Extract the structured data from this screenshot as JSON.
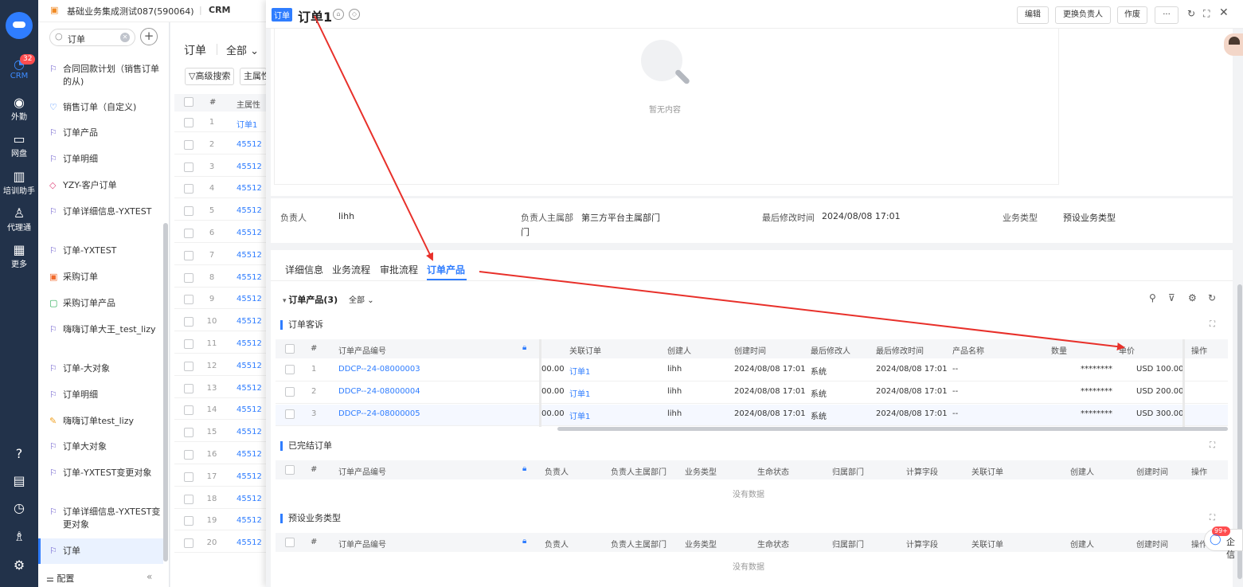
{
  "rail": {
    "badge": "32",
    "items": [
      {
        "label": "CRM",
        "icon": "crm-icon"
      },
      {
        "label": "外勤",
        "icon": "location-icon"
      },
      {
        "label": "网盘",
        "icon": "disk-icon"
      },
      {
        "label": "培训助手",
        "icon": "book-icon"
      },
      {
        "label": "代理通",
        "icon": "agent-icon"
      },
      {
        "label": "更多",
        "icon": "grid-icon"
      }
    ]
  },
  "topbar": {
    "company": "基础业务集成测试087(590064)",
    "app": "CRM"
  },
  "nav": {
    "search_value": "订单",
    "items": [
      {
        "label": "合同回款计划（销售订单的从)"
      },
      {
        "label": "销售订单（自定义)"
      },
      {
        "label": "订单产品"
      },
      {
        "label": "订单明细"
      },
      {
        "label": "YZY-客户订单"
      },
      {
        "label": "订单详细信息-YXTEST"
      },
      {
        "label": "订单-YXTEST"
      },
      {
        "label": "采购订单"
      },
      {
        "label": "采购订单产品"
      },
      {
        "label": "嗨嗨订单大王_test_lizy"
      },
      {
        "label": "订单-大对象"
      },
      {
        "label": "订单明细"
      },
      {
        "label": "嗨嗨订单test_lizy"
      },
      {
        "label": "订单大对象"
      },
      {
        "label": "订单-YXTEST变更对象"
      },
      {
        "label": "订单详细信息-YXTEST变更对象"
      },
      {
        "label": "订单"
      }
    ],
    "footer": "配置"
  },
  "list": {
    "title": "订单",
    "filter": "全部",
    "adv_search": "高级搜索",
    "owner_btn": "主属性",
    "col_num": "#",
    "col_main": "主属性",
    "rows": [
      {
        "n": "1",
        "v": "订单1"
      },
      {
        "n": "2",
        "v": "45512"
      },
      {
        "n": "3",
        "v": "45512"
      },
      {
        "n": "4",
        "v": "45512"
      },
      {
        "n": "5",
        "v": "45512"
      },
      {
        "n": "6",
        "v": "45512"
      },
      {
        "n": "7",
        "v": "45512"
      },
      {
        "n": "8",
        "v": "45512"
      },
      {
        "n": "9",
        "v": "45512"
      },
      {
        "n": "10",
        "v": "45512"
      },
      {
        "n": "11",
        "v": "45512"
      },
      {
        "n": "12",
        "v": "45512"
      },
      {
        "n": "13",
        "v": "45512"
      },
      {
        "n": "14",
        "v": "45512"
      },
      {
        "n": "15",
        "v": "45512"
      },
      {
        "n": "16",
        "v": "45512"
      },
      {
        "n": "17",
        "v": "45512"
      },
      {
        "n": "18",
        "v": "45512"
      },
      {
        "n": "19",
        "v": "45512"
      },
      {
        "n": "20",
        "v": "45512"
      }
    ]
  },
  "detail": {
    "tag": "订单",
    "title": "订单1",
    "buttons": {
      "edit": "编辑",
      "change_owner": "更换负责人",
      "void": "作废",
      "more": "···"
    },
    "empty_text": "暂无内容",
    "info": {
      "owner_label": "负责人",
      "owner_value": "lihh",
      "dept_label": "负责人主属部",
      "dept_value": "第三方平台主属部门",
      "dept_value2": "门",
      "modified_label": "最后修改时间",
      "modified_value": "2024/08/08 17:01",
      "biz_label": "业务类型",
      "biz_value": "预设业务类型"
    },
    "tabs": [
      "详细信息",
      "业务流程",
      "审批流程",
      "订单产品"
    ],
    "related_title": "订单产品(3)",
    "related_filter": "全部",
    "section1": {
      "title": "订单客诉",
      "columns": [
        "#",
        "订单产品编号",
        "关联订单",
        "创建人",
        "创建时间",
        "最后修改人",
        "最后修改时间",
        "产品名称",
        "数量",
        "单价",
        "操作"
      ],
      "rows": [
        {
          "n": "1",
          "code": "DDCP--24-08000003",
          "amt": "00.00",
          "order": "订单1",
          "creator": "lihh",
          "created": "2024/08/08 17:01",
          "modifier": "系统",
          "modified": "2024/08/08 17:01",
          "product": "--",
          "qty": "********",
          "price": "USD 100.00"
        },
        {
          "n": "2",
          "code": "DDCP--24-08000004",
          "amt": "00.00",
          "order": "订单1",
          "creator": "lihh",
          "created": "2024/08/08 17:01",
          "modifier": "系统",
          "modified": "2024/08/08 17:01",
          "product": "--",
          "qty": "********",
          "price": "USD 200.00"
        },
        {
          "n": "3",
          "code": "DDCP--24-08000005",
          "amt": "00.00",
          "order": "订单1",
          "creator": "lihh",
          "created": "2024/08/08 17:01",
          "modifier": "系统",
          "modified": "2024/08/08 17:01",
          "product": "--",
          "qty": "********",
          "price": "USD 300.00"
        }
      ]
    },
    "section2": {
      "title": "已完结订单",
      "columns": [
        "#",
        "订单产品编号",
        "负责人",
        "负责人主属部门",
        "业务类型",
        "生命状态",
        "归属部门",
        "计算字段",
        "关联订单",
        "创建人",
        "创建时间",
        "操作"
      ],
      "nodata": "没有数据"
    },
    "section3": {
      "title": "预设业务类型",
      "columns": [
        "#",
        "订单产品编号",
        "负责人",
        "负责人主属部门",
        "业务类型",
        "生命状态",
        "归属部门",
        "计算字段",
        "关联订单",
        "创建人",
        "创建时间",
        "操作"
      ],
      "nodata": "没有数据"
    },
    "chat": {
      "badge": "99+",
      "label": "企信"
    }
  },
  "colors": {
    "accent": "#2f7dff",
    "rail": "#22324a",
    "arrow": "#e8302a"
  }
}
